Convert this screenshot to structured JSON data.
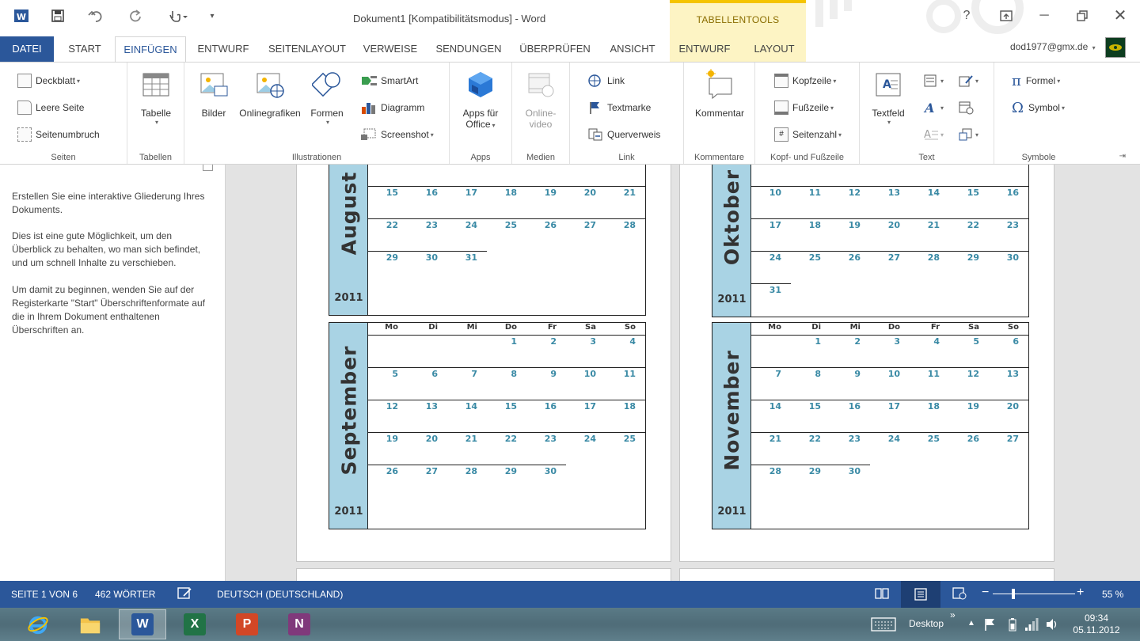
{
  "window": {
    "title": "Dokument1 [Kompatibilitätsmodus] - Word",
    "contextual_title": "TABELLENTOOLS"
  },
  "tabs": {
    "datei": "DATEI",
    "start": "START",
    "einfuegen": "EINFÜGEN",
    "entwurf": "ENTWURF",
    "seitenlayout": "SEITENLAYOUT",
    "verweise": "VERWEISE",
    "sendungen": "SENDUNGEN",
    "ueberpruefen": "ÜBERPRÜFEN",
    "ansicht": "ANSICHT",
    "tt_entwurf": "ENTWURF",
    "tt_layout": "LAYOUT"
  },
  "user": {
    "email": "dod1977@gmx.de"
  },
  "ribbon": {
    "seiten": {
      "label": "Seiten",
      "deckblatt": "Deckblatt",
      "leere_seite": "Leere Seite",
      "seitenumbruch": "Seitenumbruch"
    },
    "tabellen": {
      "label": "Tabellen",
      "tabelle": "Tabelle"
    },
    "illustrationen": {
      "label": "Illustrationen",
      "bilder": "Bilder",
      "onlinegrafiken": "Onlinegrafiken",
      "formen": "Formen",
      "smartart": "SmartArt",
      "diagramm": "Diagramm",
      "screenshot": "Screenshot"
    },
    "apps": {
      "label": "Apps",
      "apps_fuer": "Apps für",
      "office": "Office"
    },
    "medien": {
      "label": "Medien",
      "online": "Online-",
      "video": "video"
    },
    "link": {
      "label": "Link",
      "link": "Link",
      "textmarke": "Textmarke",
      "querverweis": "Querverweis"
    },
    "kommentare": {
      "label": "Kommentare",
      "kommentar": "Kommentar"
    },
    "kopf": {
      "label": "Kopf- und Fußzeile",
      "kopfzeile": "Kopfzeile",
      "fusszeile": "Fußzeile",
      "seitenzahl": "Seitenzahl"
    },
    "text": {
      "label": "Text",
      "textfeld": "Textfeld"
    },
    "symbole": {
      "label": "Symbole",
      "formel": "Formel",
      "symbol": "Symbol"
    }
  },
  "navpane": {
    "p1": "Erstellen Sie eine interaktive Gliederung Ihres Dokuments.",
    "p2": "Dies ist eine gute Möglichkeit, um den Überblick zu behalten, wo man sich befindet, und um schnell Inhalte zu verschieben.",
    "p3": "Um damit zu beginnen, wenden Sie auf der Registerkarte \"Start\" Überschriftenformate auf die in Ihrem Dokument enthaltenen Überschriften an."
  },
  "calendar": {
    "weekdays": [
      "Mo",
      "Di",
      "Mi",
      "Do",
      "Fr",
      "Sa",
      "So"
    ],
    "year": "2011",
    "months": [
      {
        "name": "August",
        "year": "2011",
        "weeks": [
          [
            "15",
            "16",
            "17",
            "18",
            "19",
            "20",
            "21"
          ],
          [
            "22",
            "23",
            "24",
            "25",
            "26",
            "27",
            "28"
          ],
          [
            "29",
            "30",
            "31",
            "",
            "",
            "",
            ""
          ]
        ]
      },
      {
        "name": "September",
        "year": "2011",
        "weeks": [
          [
            "",
            "",
            "",
            "1",
            "2",
            "3",
            "4"
          ],
          [
            "5",
            "6",
            "7",
            "8",
            "9",
            "10",
            "11"
          ],
          [
            "12",
            "13",
            "14",
            "15",
            "16",
            "17",
            "18"
          ],
          [
            "19",
            "20",
            "21",
            "22",
            "23",
            "24",
            "25"
          ],
          [
            "26",
            "27",
            "28",
            "29",
            "30",
            "",
            ""
          ]
        ]
      },
      {
        "name": "Oktober",
        "year": "2011",
        "weeks": [
          [
            "10",
            "11",
            "12",
            "13",
            "14",
            "15",
            "16"
          ],
          [
            "17",
            "18",
            "19",
            "20",
            "21",
            "22",
            "23"
          ],
          [
            "24",
            "25",
            "26",
            "27",
            "28",
            "29",
            "30"
          ],
          [
            "31",
            "",
            "",
            "",
            "",
            "",
            ""
          ]
        ]
      },
      {
        "name": "November",
        "year": "2011",
        "weeks": [
          [
            "",
            "1",
            "2",
            "3",
            "4",
            "5",
            "6"
          ],
          [
            "7",
            "8",
            "9",
            "10",
            "11",
            "12",
            "13"
          ],
          [
            "14",
            "15",
            "16",
            "17",
            "18",
            "19",
            "20"
          ],
          [
            "21",
            "22",
            "23",
            "24",
            "25",
            "26",
            "27"
          ],
          [
            "28",
            "29",
            "30",
            "",
            "",
            "",
            ""
          ]
        ]
      }
    ]
  },
  "status": {
    "page": "SEITE 1 VON 6",
    "words": "462 WÖRTER",
    "language": "DEUTSCH (DEUTSCHLAND)",
    "zoom": "55 %",
    "zoom_value": 55
  },
  "taskbar": {
    "desktop": "Desktop",
    "time": "09:34",
    "date": "05.11.2012"
  },
  "colors": {
    "accent": "#2b579a",
    "contextual": "#fdf4c4",
    "calendar_band": "#a9d3e4",
    "day_text": "#3a8aa5"
  }
}
